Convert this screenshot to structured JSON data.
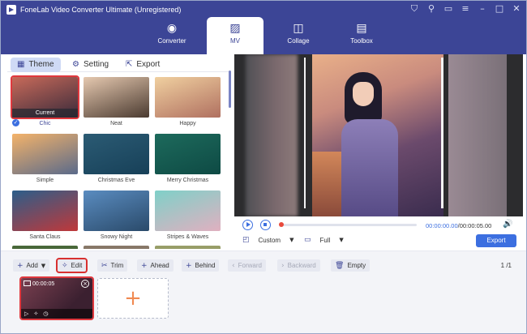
{
  "app": {
    "title": "FoneLab Video Converter Ultimate (Unregistered)",
    "window_icons": [
      "cart-icon",
      "key-icon",
      "chat-icon",
      "menu-icon",
      "minimize-icon",
      "maximize-icon",
      "close-icon"
    ],
    "window_glyphs": [
      "⛉",
      "⚲",
      "▭",
      "≡",
      "–",
      "□",
      "✕"
    ]
  },
  "nav": {
    "items": [
      {
        "label": "Converter",
        "icon": "converter-icon",
        "glyph": "◉"
      },
      {
        "label": "MV",
        "icon": "mv-icon",
        "glyph": "▨"
      },
      {
        "label": "Collage",
        "icon": "collage-icon",
        "glyph": "◫"
      },
      {
        "label": "Toolbox",
        "icon": "toolbox-icon",
        "glyph": "▤"
      }
    ],
    "active": "MV"
  },
  "subtabs": {
    "theme": "Theme",
    "setting": "Setting",
    "export": "Export"
  },
  "themes": [
    {
      "name": "Chic",
      "current": "Current",
      "selected": true,
      "colors": [
        "#c86a5a",
        "#3a2a3a"
      ]
    },
    {
      "name": "Neat",
      "colors": [
        "#e6c9b0",
        "#4a3a30"
      ]
    },
    {
      "name": "Happy",
      "colors": [
        "#f0d0a0",
        "#b07060"
      ]
    },
    {
      "name": "Simple",
      "colors": [
        "#f4b36a",
        "#5a6a8a"
      ]
    },
    {
      "name": "Christmas Eve",
      "colors": [
        "#2b5b74",
        "#174058"
      ]
    },
    {
      "name": "Merry Christmas",
      "colors": [
        "#1d6a5c",
        "#0e4a44"
      ]
    },
    {
      "name": "Santa Claus",
      "colors": [
        "#2b5e8a",
        "#c0383a"
      ]
    },
    {
      "name": "Snowy Night",
      "colors": [
        "#5a8cc0",
        "#2a4a6a"
      ]
    },
    {
      "name": "Stripes & Waves",
      "colors": [
        "#7fd0c8",
        "#e0b0c0"
      ]
    }
  ],
  "player": {
    "current_time": "00:00:00.00",
    "total_time": "00:00:05.00",
    "progress": 0
  },
  "options": {
    "aspect": "Custom",
    "size": "Full",
    "export_label": "Export"
  },
  "toolbar": {
    "add": "Add",
    "edit": "Edit",
    "trim": "Trim",
    "ahead": "Ahead",
    "behind": "Behind",
    "forward": "Forward",
    "backward": "Backward",
    "empty": "Empty",
    "page_current": "1",
    "page_sep": "/",
    "page_total": "1"
  },
  "clip": {
    "time": "00:00:05"
  },
  "colors": {
    "brand": "#3c4596",
    "accent": "#3c6fe0",
    "highlight": "#d8302f"
  }
}
